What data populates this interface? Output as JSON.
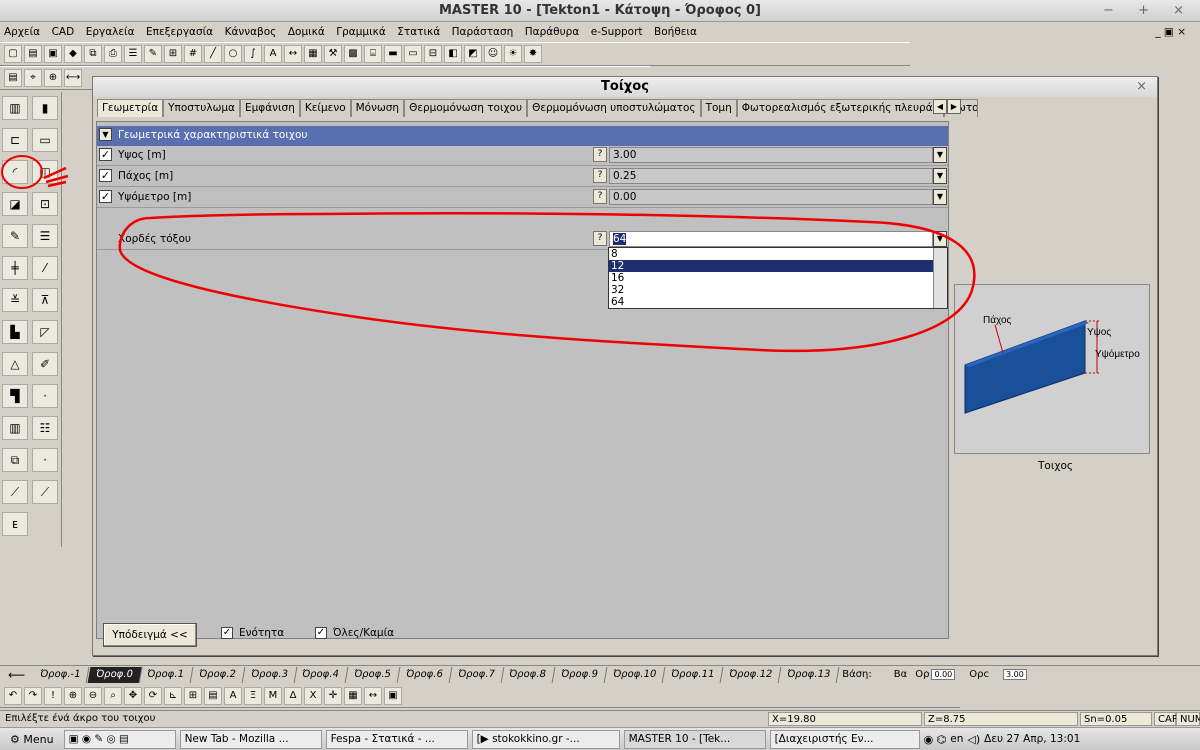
{
  "window": {
    "title": "MASTER 10 - [Tekton1 - Κάτοψη - Όροφος 0]"
  },
  "menu": [
    "Αρχεία",
    "CAD",
    "Εργαλεία",
    "Επεξεργασία",
    "Κάνναβος",
    "Δομικά",
    "Γραμμικά",
    "Στατικά",
    "Παράσταση",
    "Παράθυρα",
    "e-Support",
    "Βοήθεια"
  ],
  "dialog": {
    "title": "Τοίχος",
    "tabs": [
      "Γεωμετρία",
      "Υποστυλωμα",
      "Εμφάνιση",
      "Κείμενο",
      "Μόνωση",
      "Θερμομόνωση τοιχου",
      "Θερμομόνωση υποστυλώματος",
      "Τομη",
      "Φωτορεαλισμός εξωτερικής πλευράς",
      "Φωτορεάλ"
    ],
    "section_header": "Γεωμετρικά χαρακτηριστικά τοιχου",
    "rows": [
      {
        "label": "Υψος [m]",
        "value": "3.00"
      },
      {
        "label": "Πάχος [m]",
        "value": "0.25"
      },
      {
        "label": "Υψόμετρο [m]",
        "value": "0.00"
      }
    ],
    "chords_row": {
      "label": "Χορδές τόξου",
      "value": "64"
    },
    "help_label": "?",
    "options": [
      "8",
      "12",
      "16",
      "32",
      "64"
    ],
    "selected_option": "12",
    "sample_button": "Υπόδειγμά <<",
    "unity_label": "Ενότητα",
    "all_none_label": "Όλες/Καμία",
    "preview": {
      "pachos": "Πάχος",
      "ypsos": "Υψος",
      "ypsometro": "Υψόμετρο",
      "caption": "Τοιχος"
    },
    "accent_color": "#1f2f70"
  },
  "floors": [
    "Όροφ.-1",
    "Όροφ.0",
    "Όροφ.1",
    "Όροφ.2",
    "Όροφ.3",
    "Όροφ.4",
    "Όροφ.5",
    "Όροφ.6",
    "Όροφ.7",
    "Όροφ.8",
    "Όροφ.9",
    "Όροφ.10",
    "Όροφ.11",
    "Όροφ.12",
    "Όροφ.13"
  ],
  "floor_extra": {
    "base": "Βάση:",
    "ba": "Βα",
    "op": "Ορ",
    "op_val": "0.00",
    "orc": "Ορc",
    "val2": "3.00"
  },
  "status": {
    "hint": "Επιλέξτε ένά άκρο του τοιχου",
    "x": "X=19.80",
    "z": "Z=8.75",
    "sn": "Sn=0.05",
    "caps": "CAP",
    "num": "NUM"
  },
  "taskbar": {
    "menu": "Menu",
    "tasks": [
      "New Tab - Mozilla ...",
      "Fespa - Στατικά - ...",
      "[▶ stokokkino.gr -...",
      "MASTER 10 - [Tek...",
      "[Διαχειριστής Εν..."
    ],
    "lang": "en",
    "clock": "Δευ 27 Απρ, 13:01"
  }
}
